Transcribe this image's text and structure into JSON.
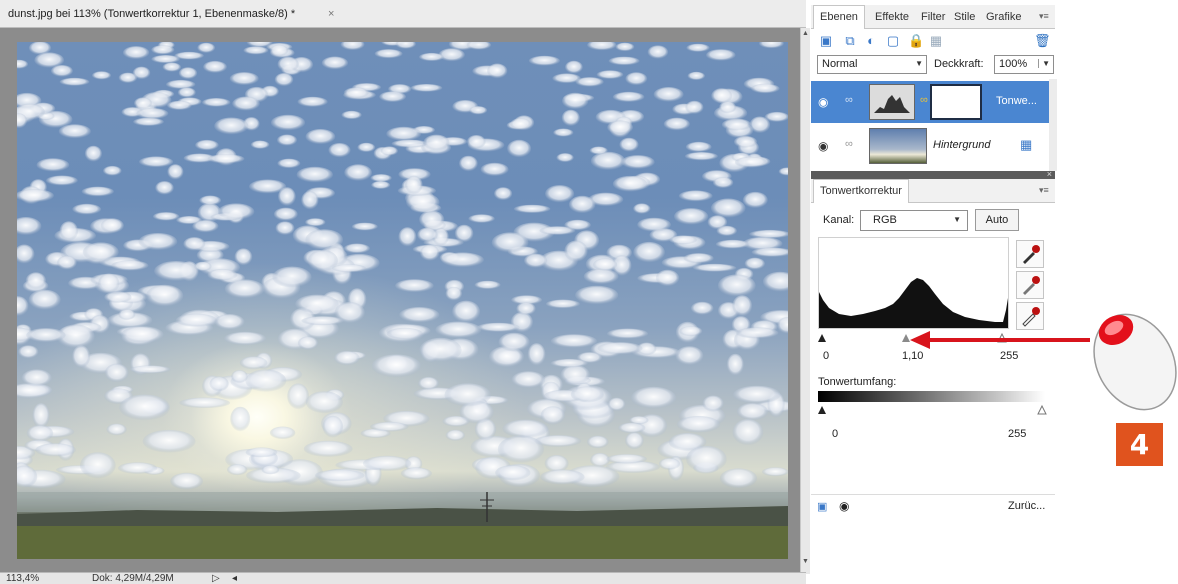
{
  "document": {
    "tab_title": "dunst.jpg bei 113% (Tonwertkorrektur 1, Ebenenmaske/8) *",
    "close_label": "×"
  },
  "status": {
    "zoom": "113,4%",
    "doc_info": "Dok: 4,29M/4,29M",
    "nav_arrow": "▷",
    "scroll_left": "◂"
  },
  "layers_panel": {
    "tabs": [
      "Ebenen",
      "Effekte",
      "Filter",
      "Stile",
      "Grafike"
    ],
    "menu_icon": "▾≡",
    "blend_mode": "Normal",
    "opacity_label": "Deckkraft:",
    "opacity_value": "100%",
    "layers": [
      {
        "name": "Tonwe...",
        "selected": true
      },
      {
        "name": "Hintergrund",
        "selected": false
      }
    ]
  },
  "adjustment_panel": {
    "tab": "Tonwertkorrektur",
    "channel_label": "Kanal:",
    "channel_value": "RGB",
    "auto_label": "Auto",
    "input_black": "0",
    "input_gamma": "1,10",
    "input_white": "255",
    "output_label": "Tonwertumfang:",
    "output_black": "0",
    "output_white": "255",
    "reset_label": "Zurüc..."
  },
  "annotation": {
    "step_number": "4"
  },
  "colors": {
    "selection_blue": "#4a86d1",
    "annotation_orange": "#e0531e",
    "arrow_red": "#d8141c"
  }
}
